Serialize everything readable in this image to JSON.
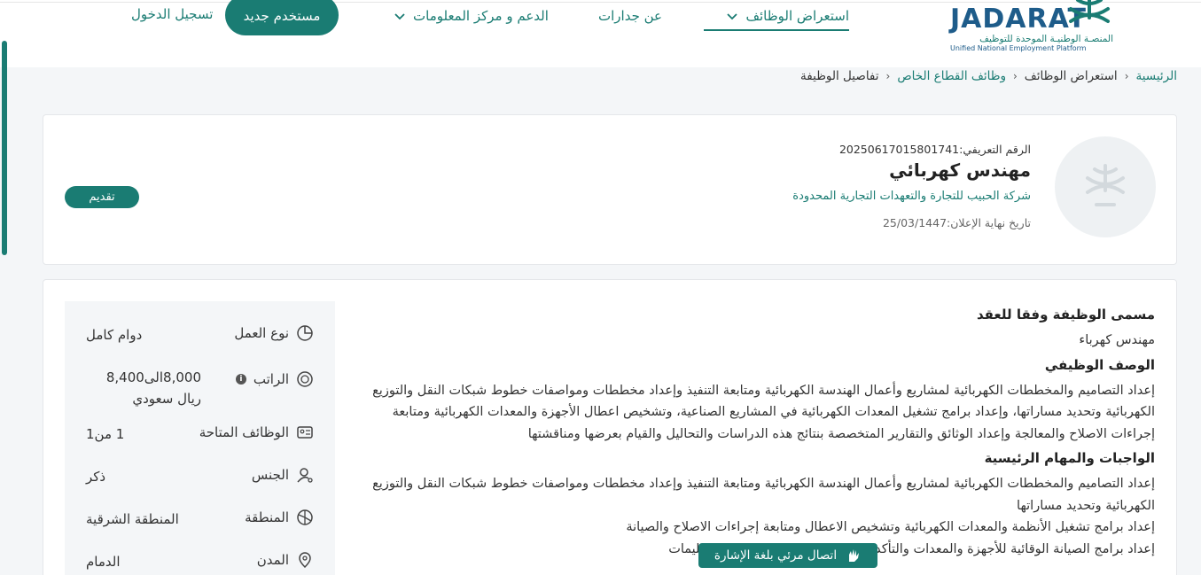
{
  "header": {
    "logo_word": "JADARAT",
    "logo_ar": "المنصـة الوطنيـة الموحدة للتوظيف",
    "logo_en": "Unified National Employment Platform",
    "nav": {
      "jobs": "استعراض الوظائف",
      "about": "عن جدارات",
      "support": "الدعم و مركز المعلومات"
    },
    "new_user": "مستخدم جديد",
    "login": "تسجيل الدخول"
  },
  "breadcrumb": {
    "home": "الرئيسية",
    "jobs": "استعراض الوظائف",
    "private": "وظائف القطاع الخاص",
    "current": "تفاصيل الوظيفة"
  },
  "job": {
    "ref": "الرقم التعريفي:20250617015801741",
    "title": "مهندس كهربائي",
    "company": "شركة الحبيب للتجارة والتعهدات التجارية المحدودة",
    "deadline": "تاريخ نهاية الإعلان:25/03/1447",
    "apply": "تقديم"
  },
  "details": {
    "contract_title_heading": "مسمى الوظيفة وفقا للعقد",
    "contract_title": "مهندس كهرباء",
    "description_heading": "الوصف الوظيفي",
    "description": "إعداد التصاميم والمخططات الكهربائية لمشاريع وأعمال الهندسة الكهربائية ومتابعة التنفيذ وإعداد مخططات ومواصفات خطوط شبكات النقل والتوزيع الكهربائية وتحديد مساراتها، وإعداد برامج تشغيل المعدات الكهربائية في المشاريع الصناعية، وتشخيص اعطال الأجهزة والمعدات الكهربائية ومتابعة إجراءات الاصلاح والمعالجة وإعداد الوثائق والتقارير المتخصصة بنتائج هذه الدراسات والتحاليل والقيام بعرضها ومناقشتها",
    "duties_heading": "الواجبات والمهام الرئيسية",
    "duty1": "إعداد التصاميم والمخططات الكهربائية لمشاريع وأعمال الهندسة الكهربائية ومتابعة التنفيذ وإعداد مخططات ومواصفات خطوط شبكات النقل والتوزيع الكهربائية وتحديد مساراتها",
    "duty2": "إعداد برامج تشغيل الأنظمة والمعدات الكهربائية وتشخيص الاعطال ومتابعة إجراءات الاصلاح والصيانة",
    "duty3": "إعداد برامج الصيانة الوقائية للأجهزة والمعدات والتأكد من التزام الشركة بالصناعة والتعليمات"
  },
  "sidebar": {
    "work_type_label": "نوع العمل",
    "work_type": "دوام كامل",
    "salary_label": "الراتب",
    "salary": "8,000الى8,400 ريال سعودي",
    "salary_info": "i",
    "vacancies_label": "الوظائف المتاحة",
    "vacancies": "1 من1",
    "gender_label": "الجنس",
    "gender": "ذكر",
    "region_label": "المنطقة",
    "region": "المنطقة الشرقية",
    "city_label": "المدن",
    "city": "الدمام"
  },
  "sign_language": "اتصال مرئي بلغة الإشارة",
  "colors": {
    "primary": "#1a7c73",
    "logo_blue": "#1e5c8a"
  }
}
